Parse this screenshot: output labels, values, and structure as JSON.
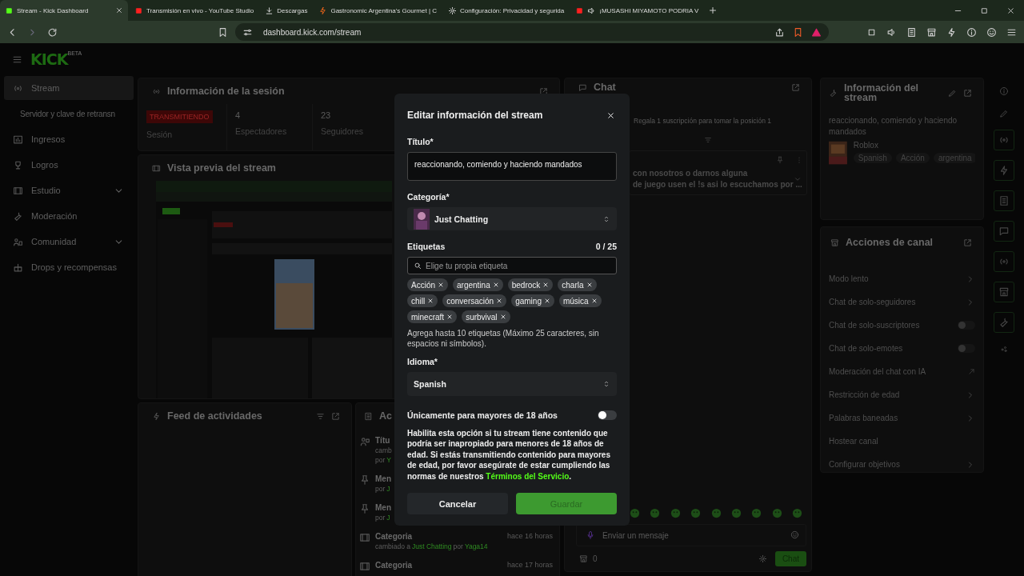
{
  "browser": {
    "tabs": [
      {
        "label": "Stream - Kick Dashboard",
        "selected": true
      },
      {
        "label": "Transmisión en vivo - YouTube Studio",
        "selected": false
      },
      {
        "label": "Descargas",
        "selected": false
      },
      {
        "label": "Gastronomic Argentina's Gourmet | C",
        "selected": false
      },
      {
        "label": "Configuración: Privacidad y segurida",
        "selected": false
      },
      {
        "label": "¡MUSASHI MIYAMOTO PODRIA V",
        "selected": false
      }
    ],
    "url": "dashboard.kick.com/stream"
  },
  "sidebar": {
    "logo": "KICK",
    "logo_badge": "BETA",
    "items": [
      {
        "label": "Stream",
        "kind": "item",
        "selected": true,
        "expandable": false
      },
      {
        "label": "Servidor y clave de retransn",
        "kind": "sub",
        "selected": false,
        "expandable": false
      },
      {
        "label": "Ingresos",
        "kind": "item",
        "selected": false,
        "expandable": false
      },
      {
        "label": "Logros",
        "kind": "item",
        "selected": false,
        "expandable": false
      },
      {
        "label": "Estudio",
        "kind": "item",
        "selected": false,
        "expandable": true
      },
      {
        "label": "Moderación",
        "kind": "item",
        "selected": false,
        "expandable": false
      },
      {
        "label": "Comunidad",
        "kind": "item",
        "selected": false,
        "expandable": true
      },
      {
        "label": "Drops y recompensas",
        "kind": "item",
        "selected": false,
        "expandable": false
      }
    ]
  },
  "session": {
    "title": "Información de la sesión",
    "status": "TRANSMITIENDO",
    "status_caption": "Sesión",
    "stats": [
      {
        "value": "4",
        "label": "Espectadores"
      },
      {
        "value": "23",
        "label": "Seguidores"
      }
    ]
  },
  "preview": {
    "title": "Vista previa del stream"
  },
  "feed": {
    "title": "Feed de actividades"
  },
  "mod_actions": {
    "title": "Ac",
    "items": [
      {
        "title": "Títu",
        "lines": [
          [
            {
              "text": "camb",
              "accent": false
            }
          ],
          [
            {
              "text": "por",
              "accent": false
            },
            {
              "text": "Y",
              "accent": true
            }
          ]
        ]
      },
      {
        "title": "Men",
        "lines": [
          [
            {
              "text": "por",
              "accent": false
            },
            {
              "text": "J",
              "accent": true
            }
          ]
        ]
      },
      {
        "title": "Men",
        "lines": [
          [
            {
              "text": "por",
              "accent": false
            },
            {
              "text": "J",
              "accent": true
            }
          ]
        ]
      },
      {
        "title": "Categoria",
        "time": "hace 16 horas",
        "lines": [
          [
            {
              "text": "cambiado a",
              "accent": false
            },
            {
              "text": "Just Chatting",
              "accent": true
            },
            {
              "text": "por",
              "accent": false
            },
            {
              "text": "Yaga14",
              "accent": true
            }
          ]
        ]
      },
      {
        "title": "Categoria",
        "time": "hace 17 horas"
      }
    ]
  },
  "chat": {
    "title": "Chat",
    "promo": "Regala 1 suscripción para tomar la posición 1",
    "pinned": [
      "con nosotros o darnos alguna",
      "de juego usen el !s asi lo escuchamos por ..."
    ],
    "placeholder": "Enviar un mensaje",
    "count": "0",
    "send": "Chat"
  },
  "stream_info": {
    "title": "Información del stream",
    "stream_title": "reaccionando, comiendo y haciendo mandados",
    "category": "Roblox",
    "tags": [
      "Spanish",
      "Acción",
      "argentina"
    ]
  },
  "channel_actions": {
    "title": "Acciones de canal",
    "items": [
      {
        "label": "Modo lento",
        "kind": "chevron"
      },
      {
        "label": "Chat de solo-seguidores",
        "kind": "chevron"
      },
      {
        "label": "Chat de solo-suscriptores",
        "kind": "toggle",
        "on": false
      },
      {
        "label": "Chat de solo-emotes",
        "kind": "toggle",
        "on": false
      },
      {
        "label": "Moderación del chat con IA",
        "kind": "external"
      },
      {
        "label": "Restricción de edad",
        "kind": "chevron"
      },
      {
        "label": "Palabras baneadas",
        "kind": "chevron"
      },
      {
        "label": "Hostear canal",
        "kind": "plain"
      },
      {
        "label": "Configurar objetivos",
        "kind": "chevron"
      }
    ]
  },
  "modal": {
    "title": "Editar información del stream",
    "title_label": "Título*",
    "title_value": "reaccionando, comiendo y haciendo mandados",
    "category_label": "Categoría*",
    "category_value": "Just Chatting",
    "tags_label": "Etiquetas",
    "tags_count": "0 / 25",
    "tags_placeholder": "Elige tu propia etiqueta",
    "tags": [
      "Acción",
      "argentina",
      "bedrock",
      "charla",
      "chill",
      "conversación",
      "gaming",
      "música",
      "minecraft",
      "surbvival"
    ],
    "tags_help": "Agrega hasta 10 etiquetas (Máximo 25 caracteres, sin espacios ni símbolos).",
    "language_label": "Idioma*",
    "language_value": "Spanish",
    "mature_label": "Únicamente para mayores de 18 años",
    "mature_on": false,
    "mature_help": "Habilita esta opción si tu stream tiene contenido que podría ser inapropiado para menores de 18 años de edad. Si estás transmitiendo contenido para mayores de edad, por favor asegúrate de estar cumpliendo las normas de nuestros",
    "terms_link": "Términos del Servicio",
    "mature_help_end": ".",
    "cancel": "Cancelar",
    "save": {
      "label": "Guardar",
      "disabled": true
    }
  }
}
